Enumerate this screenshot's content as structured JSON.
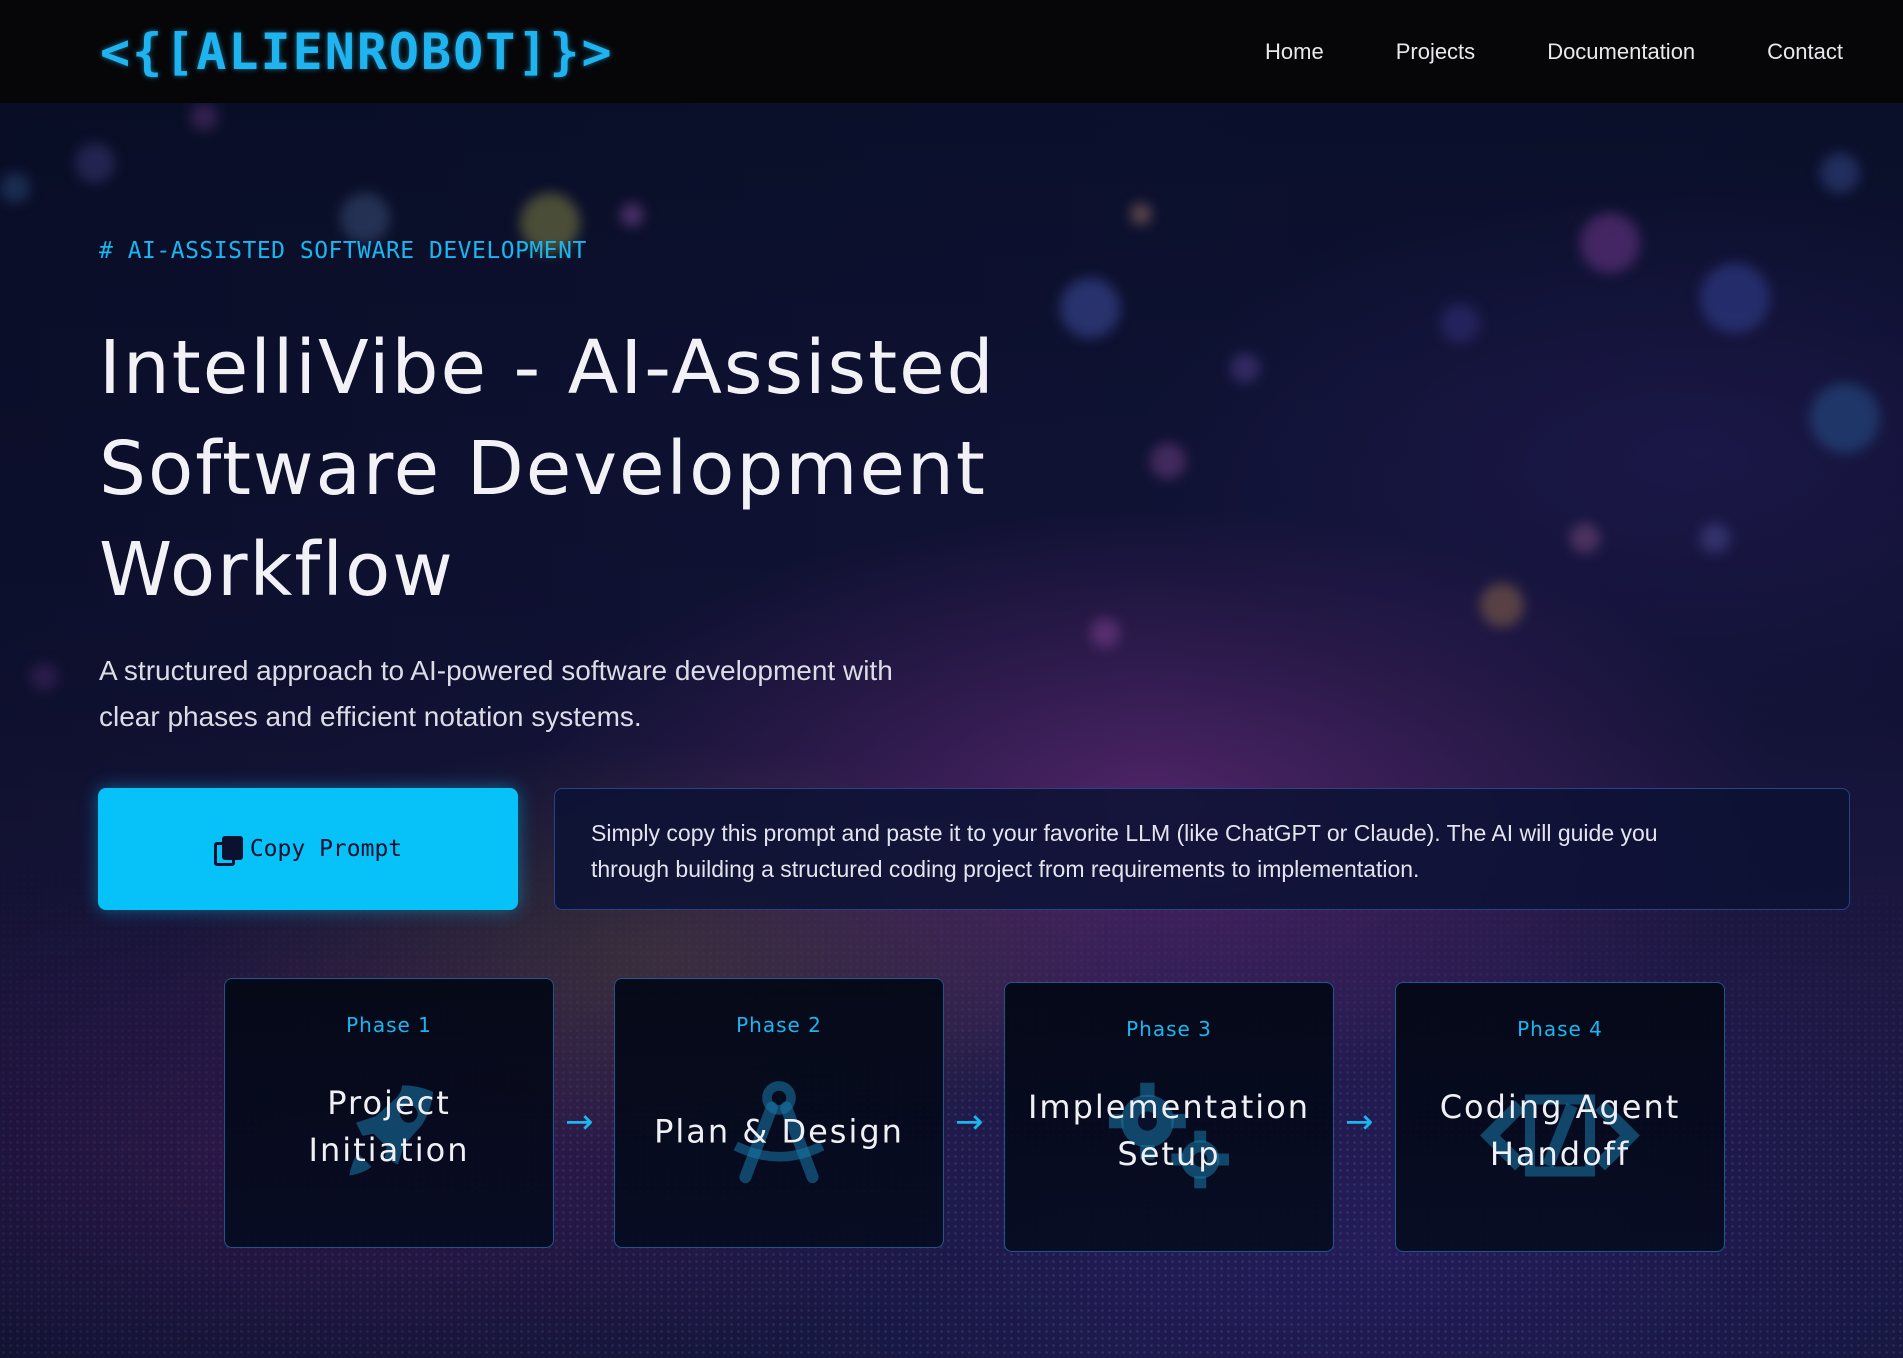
{
  "header": {
    "logo": "<{[ALIENROBOT]}>",
    "nav": [
      "Home",
      "Projects",
      "Documentation",
      "Contact"
    ]
  },
  "hero": {
    "eyebrow": "# AI-ASSISTED SOFTWARE DEVELOPMENT",
    "title_lines": [
      "IntelliVibe - AI-Assisted",
      "Software Development",
      "Workflow"
    ],
    "subtitle_lines": [
      "A structured approach to AI-powered software development with",
      "clear phases and efficient notation systems."
    ]
  },
  "actions": {
    "copy_label": "Copy Prompt",
    "copy_icon": "copy-icon",
    "info_lines": [
      "Simply copy this prompt and paste it to your favorite LLM (like ChatGPT or Claude). The AI will guide you",
      "through building a structured coding project from requirements to implementation."
    ]
  },
  "phases": [
    {
      "label": "Phase 1",
      "title_lines": [
        "Project",
        "Initiation"
      ],
      "icon": "rocket-icon"
    },
    {
      "label": "Phase 2",
      "title_lines": [
        "Plan & Design"
      ],
      "icon": "compass-icon"
    },
    {
      "label": "Phase 3",
      "title_lines": [
        "Implementation",
        "Setup"
      ],
      "icon": "gears-icon"
    },
    {
      "label": "Phase 4",
      "title_lines": [
        "Coding Agent",
        "Handoff"
      ],
      "icon": "code-icon"
    }
  ],
  "arrow_glyph": "→",
  "colors": {
    "accent": "#06c2f8",
    "header_bg": "#060608",
    "label_cyan": "#19b6f0"
  }
}
